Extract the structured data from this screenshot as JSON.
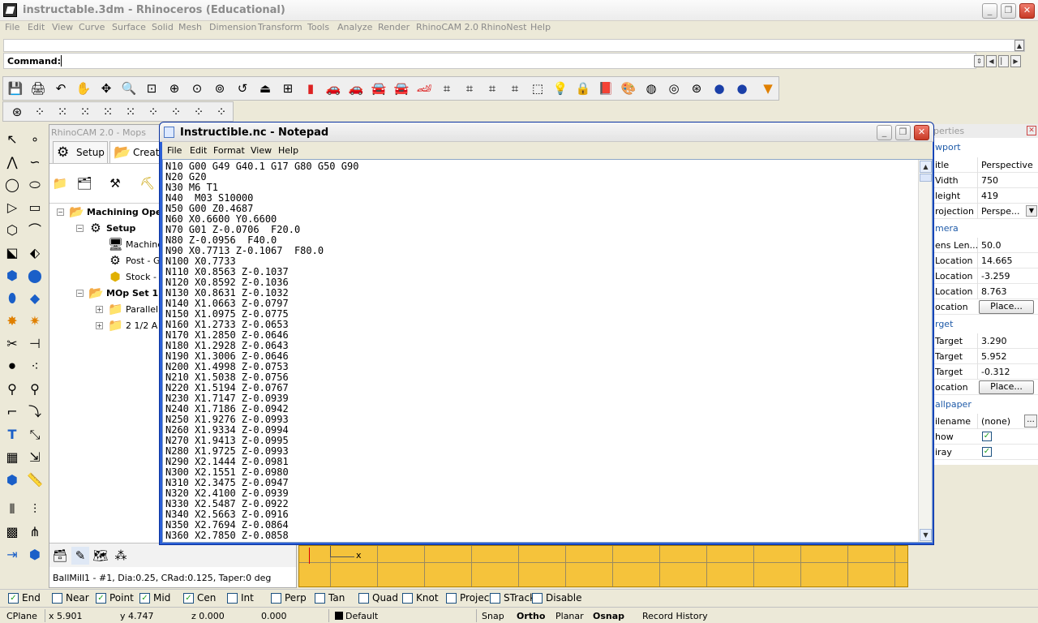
{
  "app": {
    "title": "instructable.3dm - Rhinoceros (Educational)",
    "menu": [
      "File",
      "Edit",
      "View",
      "Curve",
      "Surface",
      "Solid",
      "Mesh",
      "Dimension",
      "Transform",
      "Tools",
      "Analyze",
      "Render",
      "RhinoCAM 2.0",
      "RhinoNest",
      "Help"
    ],
    "command_label": "Command:"
  },
  "rhinocam": {
    "panel_title": "RhinoCAM 2.0 - Mops",
    "tabs": [
      "Setup",
      "Create"
    ],
    "tree": {
      "root": "Machining Ope",
      "setup": "Setup",
      "machine": "Machine",
      "post": "Post - G",
      "stock": "Stock -",
      "mop_set": "MOp Set 1",
      "parallel": "Parallel",
      "two_half": "2 1/2 A"
    },
    "status": "BallMill1 - #1, Dia:0.25, CRad:0.125, Taper:0 deg"
  },
  "notepad": {
    "title": "Instructible.nc - Notepad",
    "menu": [
      "File",
      "Edit",
      "Format",
      "View",
      "Help"
    ],
    "lines": [
      "N10 G00 G49 G40.1 G17 G80 G50 G90",
      "N20 G20",
      "N30 M6 T1",
      "N40  M03 S10000",
      "N50 G00 Z0.4687",
      "N60 X0.6600 Y0.6600",
      "N70 G01 Z-0.0706  F20.0",
      "N80 Z-0.0956  F40.0",
      "N90 X0.7713 Z-0.1067  F80.0",
      "N100 X0.7733",
      "N110 X0.8563 Z-0.1037",
      "N120 X0.8592 Z-0.1036",
      "N130 X0.8631 Z-0.1032",
      "N140 X1.0663 Z-0.0797",
      "N150 X1.0975 Z-0.0775",
      "N160 X1.2733 Z-0.0653",
      "N170 X1.2850 Z-0.0646",
      "N180 X1.2928 Z-0.0643",
      "N190 X1.3006 Z-0.0646",
      "N200 X1.4998 Z-0.0753",
      "N210 X1.5038 Z-0.0756",
      "N220 X1.5194 Z-0.0767",
      "N230 X1.7147 Z-0.0939",
      "N240 X1.7186 Z-0.0942",
      "N250 X1.9276 Z-0.0993",
      "N260 X1.9334 Z-0.0994",
      "N270 X1.9413 Z-0.0995",
      "N280 X1.9725 Z-0.0993",
      "N290 X2.1444 Z-0.0981",
      "N300 X2.1551 Z-0.0980",
      "N310 X2.3475 Z-0.0947",
      "N320 X2.4100 Z-0.0939",
      "N330 X2.5487 Z-0.0922",
      "N340 X2.5663 Z-0.0916",
      "N350 X2.7694 Z-0.0864",
      "N360 X2.7850 Z-0.0858"
    ]
  },
  "properties": {
    "title": "perties",
    "viewport_section": "wport",
    "title_row": {
      "k": "itle",
      "v": "Perspective"
    },
    "width_row": {
      "k": "Vidth",
      "v": "750"
    },
    "height_row": {
      "k": "leight",
      "v": "419"
    },
    "projection_row": {
      "k": "rojection",
      "v": "Perspe..."
    },
    "camera_section": "mera",
    "lens_row": {
      "k": "ens Len...",
      "v": "50.0"
    },
    "xloc_row": {
      "k": "Location",
      "v": "14.665"
    },
    "yloc_row": {
      "k": "Location",
      "v": "-3.259"
    },
    "zloc_row": {
      "k": "Location",
      "v": "8.763"
    },
    "loc_row": {
      "k": "ocation",
      "v": "Place..."
    },
    "target_section": "rget",
    "xt_row": {
      "k": "Target",
      "v": "3.290"
    },
    "yt_row": {
      "k": "Target",
      "v": "5.952"
    },
    "zt_row": {
      "k": "Target",
      "v": "-0.312"
    },
    "tloc_row": {
      "k": "ocation",
      "v": "Place..."
    },
    "wall_section": "allpaper",
    "fname_row": {
      "k": "ilename",
      "v": "(none)"
    },
    "more_label": "...",
    "show_row": {
      "k": "how"
    },
    "gray_row": {
      "k": "iray"
    }
  },
  "osnaps": [
    {
      "label": "End",
      "checked": true
    },
    {
      "label": "Near",
      "checked": false
    },
    {
      "label": "Point",
      "checked": true
    },
    {
      "label": "Mid",
      "checked": true
    },
    {
      "label": "Cen",
      "checked": true
    },
    {
      "label": "Int",
      "checked": false
    },
    {
      "label": "Perp",
      "checked": false
    },
    {
      "label": "Tan",
      "checked": false
    },
    {
      "label": "Quad",
      "checked": false
    },
    {
      "label": "Knot",
      "checked": false
    },
    {
      "label": "Project",
      "checked": false
    },
    {
      "label": "STrack",
      "checked": false
    },
    {
      "label": "Disable",
      "checked": false
    }
  ],
  "statusbar": {
    "cplane": "CPlane",
    "x": "x 5.901",
    "y": "y 4.747",
    "z": "z 0.000",
    "dist": "0.000",
    "layer": "Default",
    "snap": "Snap",
    "ortho": "Ortho",
    "planar": "Planar",
    "osnap": "Osnap",
    "history": "Record History"
  },
  "viewport_axis": "x",
  "colors": {
    "viewport": "#f5c33b",
    "notepad_border": "#2b5fd6",
    "close": "#c73a26"
  }
}
